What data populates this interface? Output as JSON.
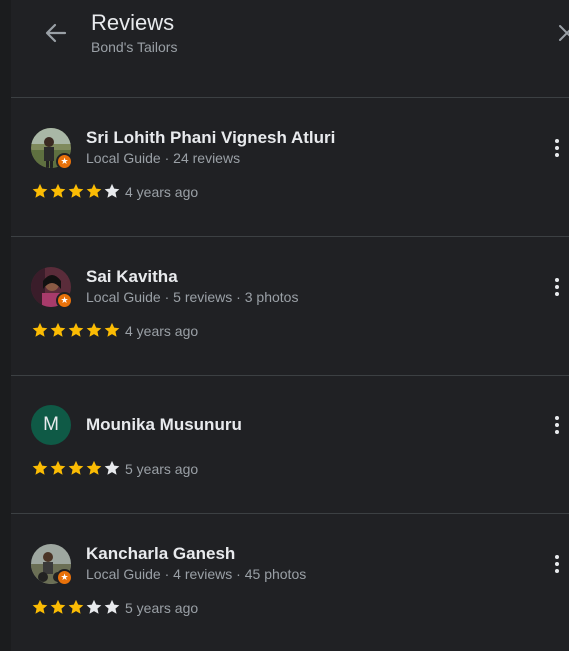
{
  "header": {
    "title": "Reviews",
    "subtitle": "Bond's Tailors"
  },
  "colors": {
    "star_filled": "#fbbc04",
    "star_empty": "#e8eaed",
    "badge": "#e8710a",
    "letter_avatar": "#0f5a46"
  },
  "reviews": [
    {
      "name": "Sri Lohith Phani Vignesh Atluri",
      "meta": "Local Guide · 24 reviews",
      "rating": 4,
      "time": "4 years ago",
      "avatar": "photo",
      "local_guide": true
    },
    {
      "name": "Sai Kavitha",
      "meta": "Local Guide · 5 reviews · 3 photos",
      "rating": 5,
      "time": "4 years ago",
      "avatar": "photo",
      "local_guide": true
    },
    {
      "name": "Mounika Musunuru",
      "meta": "",
      "rating": 4,
      "time": "5 years ago",
      "avatar": "letter",
      "avatar_letter": "M",
      "local_guide": false
    },
    {
      "name": "Kancharla Ganesh",
      "meta": "Local Guide · 4 reviews · 45 photos",
      "rating": 3,
      "time": "5 years ago",
      "avatar": "photo",
      "local_guide": true
    }
  ],
  "icons": {
    "back": "arrow-left-icon",
    "close": "close-icon",
    "more": "more-vert-icon",
    "star": "star-icon",
    "badge": "local-guide-star-icon"
  }
}
